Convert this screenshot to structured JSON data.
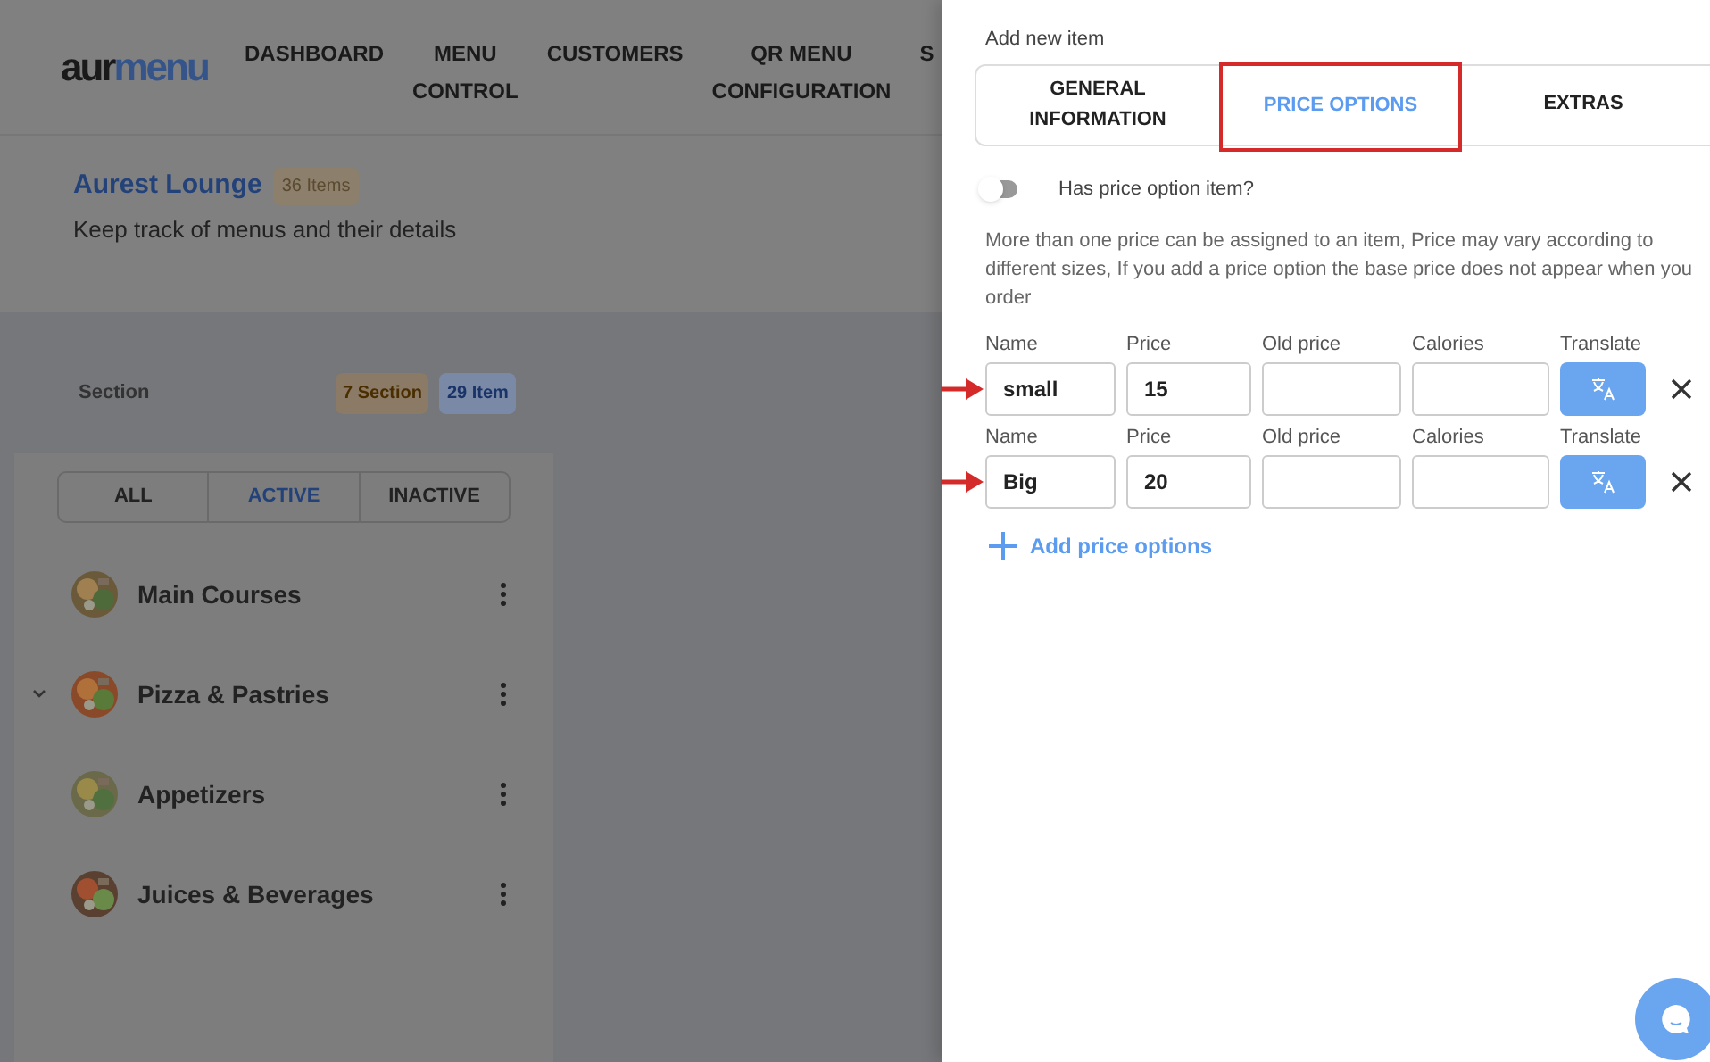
{
  "logo": {
    "dark": "aur",
    "accent": "menu"
  },
  "nav": [
    {
      "lines": [
        "DASHBOARD"
      ]
    },
    {
      "lines": [
        "MENU",
        "CONTROL"
      ]
    },
    {
      "lines": [
        "CUSTOMERS"
      ]
    },
    {
      "lines": [
        "QR MENU",
        "CONFIGURATION"
      ]
    },
    {
      "lines": [
        "S"
      ]
    }
  ],
  "page": {
    "title": "Aurest Lounge",
    "badge": "36 Items",
    "subtitle": "Keep track of menus and their details"
  },
  "sections_bar": {
    "label": "Section",
    "sections_badge": "7 Section",
    "items_badge": "29 Item"
  },
  "filters": [
    {
      "label": "ALL",
      "selected": false
    },
    {
      "label": "ACTIVE",
      "selected": true
    },
    {
      "label": "INACTIVE",
      "selected": false
    }
  ],
  "sections": [
    {
      "name": "Main Courses",
      "chevron": false
    },
    {
      "name": "Pizza & Pastries",
      "chevron": true
    },
    {
      "name": "Appetizers",
      "chevron": false
    },
    {
      "name": "Juices & Beverages",
      "chevron": false
    }
  ],
  "drawer": {
    "heading": "Add new item",
    "tabs": [
      {
        "label": "GENERAL INFORMATION",
        "selected": false,
        "highlighted": false
      },
      {
        "label": "PRICE OPTIONS",
        "selected": true,
        "highlighted": true
      },
      {
        "label": "EXTRAS",
        "selected": false,
        "highlighted": false
      }
    ],
    "toggle": {
      "label": "Has price option item?",
      "on": false
    },
    "note": "More than one price can be assigned to an item, Price may vary according to different sizes, If you add a price option the base price does not appear when you order",
    "rows": [
      {
        "labels": [
          "Name",
          "Price",
          "Old price",
          "Calories",
          "Translate"
        ],
        "name": "small",
        "price": "15",
        "marked": true
      },
      {
        "labels": [
          "Name",
          "Price",
          "Old price",
          "Calories",
          "Translate"
        ],
        "name": "Big",
        "price": "20",
        "marked": true
      }
    ],
    "add_link": "Add price options"
  }
}
